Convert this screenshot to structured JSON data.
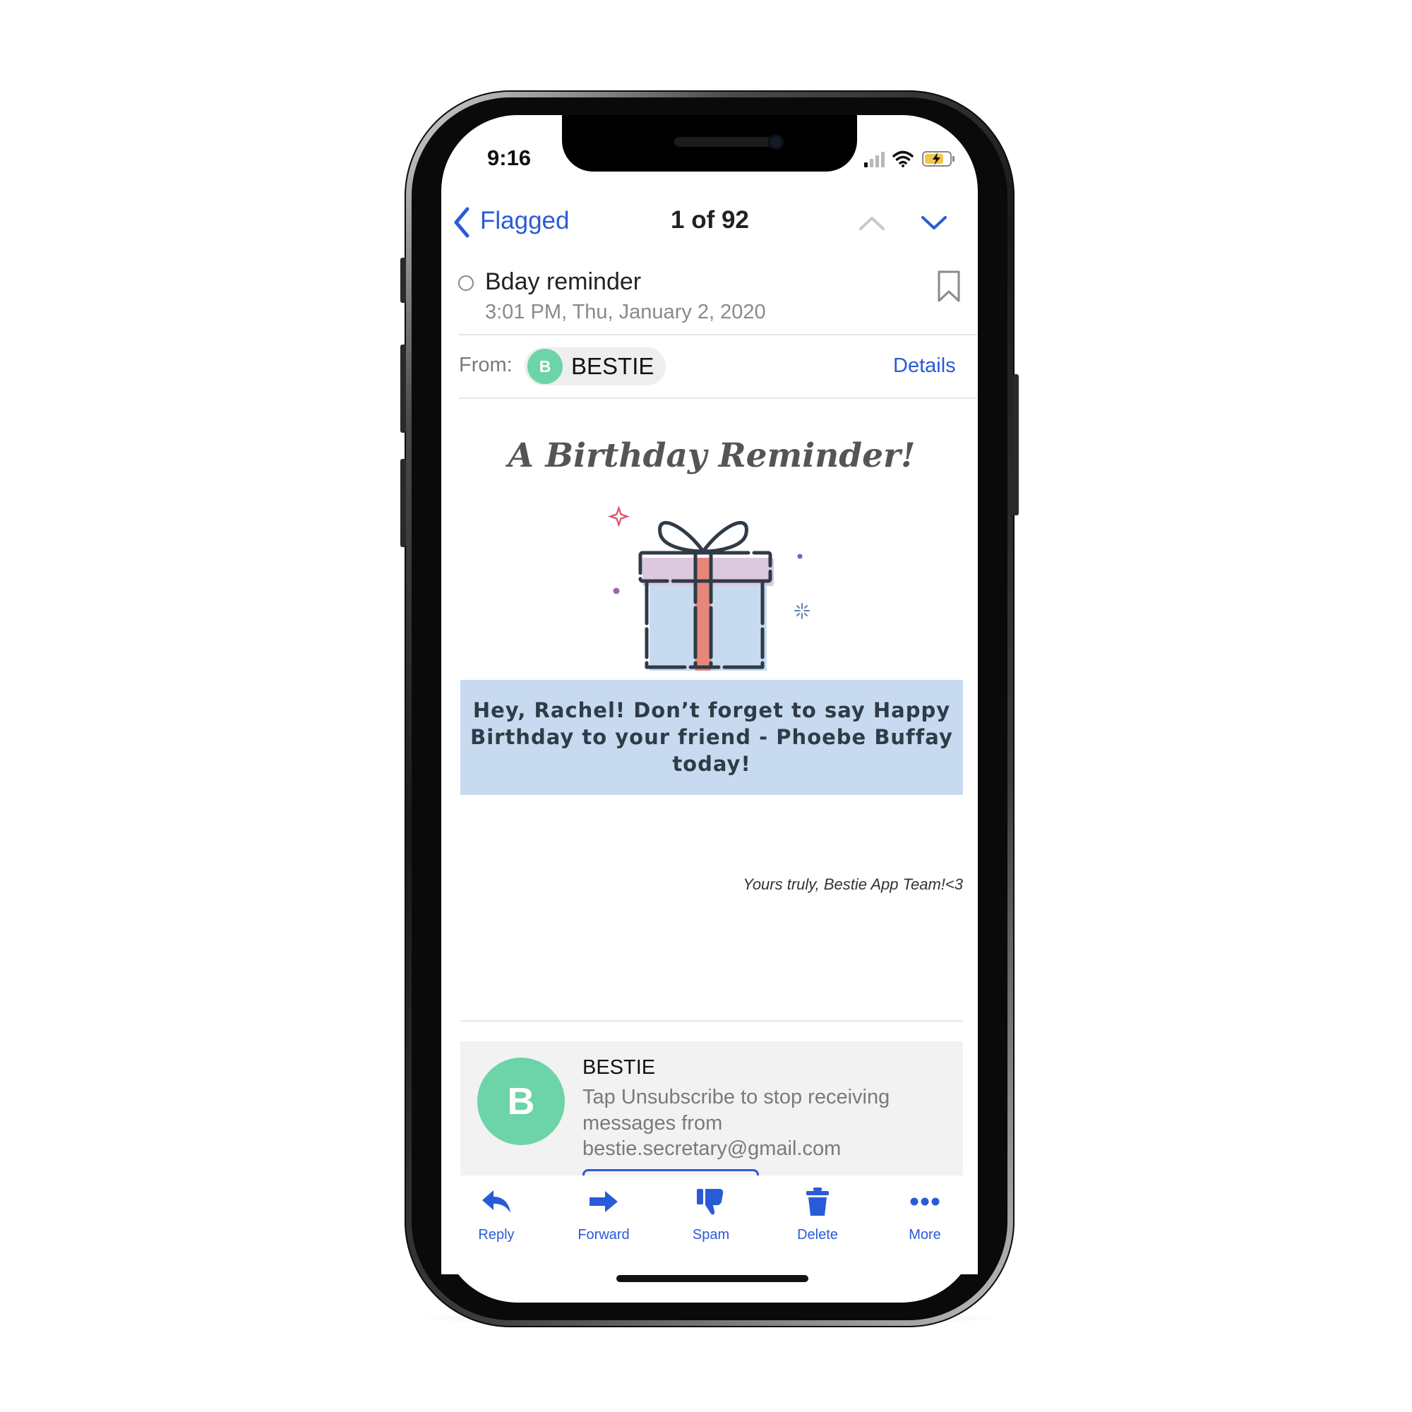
{
  "status_bar": {
    "time": "9:16"
  },
  "nav": {
    "back_label": "Flagged",
    "position": "1 of 92"
  },
  "email": {
    "subject": "Bday reminder",
    "date": "3:01 PM, Thu, January 2, 2020",
    "from_label": "From:",
    "sender_initial": "B",
    "sender_name": "BESTIE",
    "details_label": "Details"
  },
  "body": {
    "headline": "A Birthday Reminder!",
    "message": "Hey, Rachel! Don’t forget to say Happy Birthday to your friend - Phoebe Buffay today!",
    "signoff": "Yours truly, Bestie App Team!<3"
  },
  "unsubscribe": {
    "initial": "B",
    "name": "BESTIE",
    "line1": "Tap Unsubscribe to stop receiving",
    "line2": "messages from",
    "line3": "bestie.secretary@gmail.com"
  },
  "toolbar": {
    "reply": "Reply",
    "forward": "Forward",
    "spam": "Spam",
    "delete": "Delete",
    "more": "More"
  },
  "colors": {
    "accent": "#2a5bd7",
    "avatar": "#6dd3a8",
    "message_bg": "#c7daf0",
    "ribbon": "#e5887a",
    "gift_lid": "#dcc8df",
    "gift_box": "#c7daf0"
  }
}
